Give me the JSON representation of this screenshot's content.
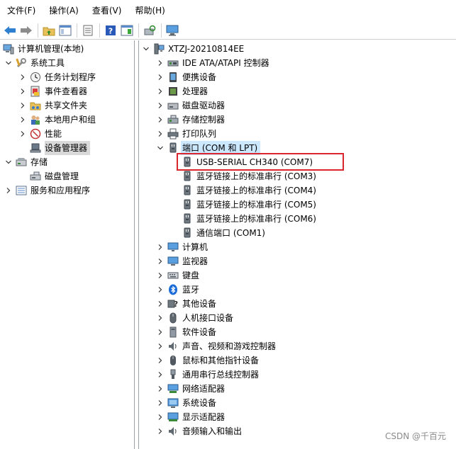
{
  "menu": [
    "文件(F)",
    "操作(A)",
    "查看(V)",
    "帮助(H)"
  ],
  "left_tree": {
    "root": "计算机管理(本地)",
    "system_tools": "系统工具",
    "task_scheduler": "任务计划程序",
    "event_viewer": "事件查看器",
    "shared_folders": "共享文件夹",
    "local_users": "本地用户和组",
    "performance": "性能",
    "device_manager": "设备管理器",
    "storage": "存储",
    "disk_management": "磁盘管理",
    "services_apps": "服务和应用程序"
  },
  "device_tree": {
    "computer_name": "XTZJ-20210814EE",
    "categories_top": [
      "IDE ATA/ATAPI 控制器",
      "便携设备",
      "处理器",
      "磁盘驱动器",
      "存储控制器",
      "打印队列"
    ],
    "ports_category": "端口 (COM 和 LPT)",
    "ports": [
      "USB-SERIAL CH340 (COM7)",
      "蓝牙链接上的标准串行 (COM3)",
      "蓝牙链接上的标准串行 (COM4)",
      "蓝牙链接上的标准串行 (COM5)",
      "蓝牙链接上的标准串行 (COM6)",
      "通信端口 (COM1)"
    ],
    "categories_bottom": [
      "计算机",
      "监视器",
      "键盘",
      "蓝牙",
      "其他设备",
      "人机接口设备",
      "软件设备",
      "声音、视频和游戏控制器",
      "鼠标和其他指针设备",
      "通用串行总线控制器",
      "网络适配器",
      "系统设备",
      "显示适配器",
      "音频输入和输出"
    ]
  },
  "watermark": "CSDN @千百元",
  "colors": {
    "highlight_box": "#d9262c",
    "selection": "#cce8ff"
  }
}
